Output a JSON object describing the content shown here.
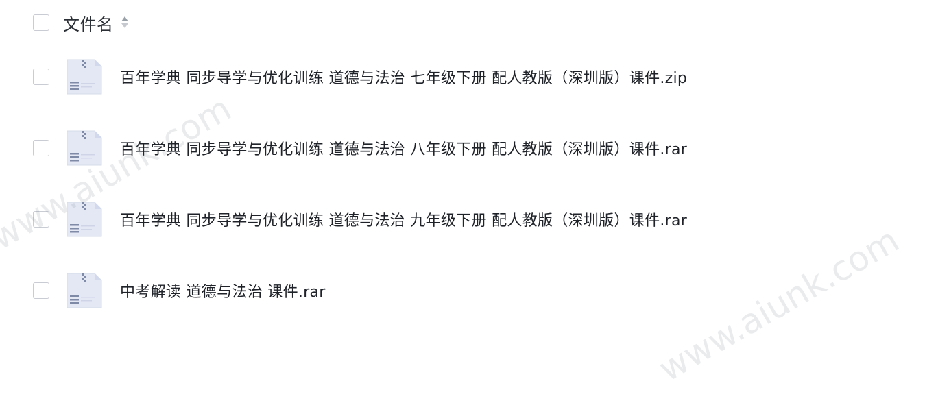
{
  "header": {
    "label": "文件名"
  },
  "files": [
    {
      "name": "百年学典 同步导学与优化训练 道德与法治 七年级下册 配人教版（深圳版）课件.zip",
      "icon": "zip-archive-icon"
    },
    {
      "name": "百年学典 同步导学与优化训练 道德与法治 八年级下册 配人教版（深圳版）课件.rar",
      "icon": "zip-archive-icon"
    },
    {
      "name": "百年学典 同步导学与优化训练 道德与法治 九年级下册 配人教版（深圳版）课件.rar",
      "icon": "zip-archive-icon"
    },
    {
      "name": "中考解读 道德与法治 课件.rar",
      "icon": "zip-archive-icon"
    }
  ],
  "watermark": "www.aiunk.com",
  "colors": {
    "checkbox_border": "#c9ccd3",
    "icon_fill": "#e4e8f5",
    "icon_line": "#7f8aa6"
  }
}
